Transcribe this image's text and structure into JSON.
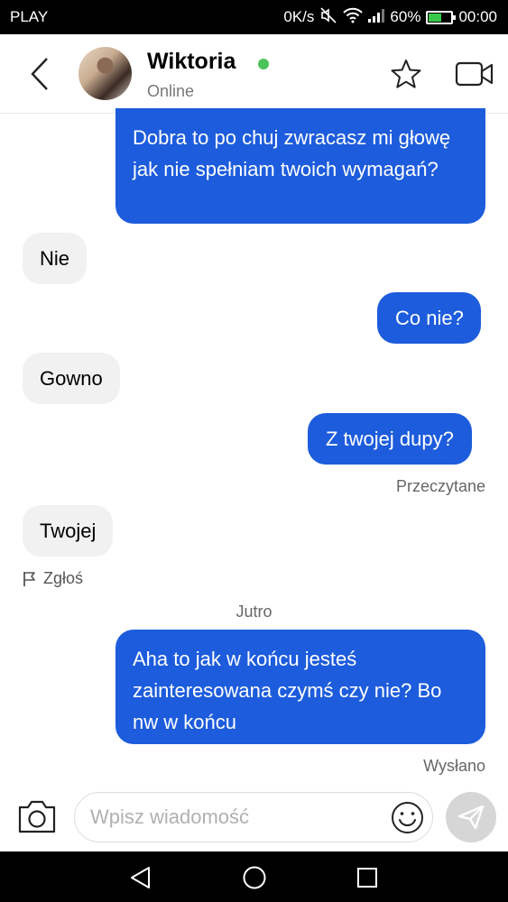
{
  "status_bar": {
    "carrier": "PLAY",
    "network_speed": "0K/s",
    "battery_percent": "60%",
    "battery_level": 0.6,
    "time": "00:00"
  },
  "header": {
    "contact_name": "Wiktoria",
    "contact_status": "Online",
    "online_color": "#4cc25a",
    "icons": [
      "chevron-left-icon",
      "star-icon",
      "video-camera-icon"
    ]
  },
  "conversation": {
    "messages": [
      {
        "direction": "outgoing",
        "text": "Dobra to po chuj zwracasz mi głowę jak nie spełniam twoich wymagań?"
      },
      {
        "direction": "incoming",
        "text": "Nie"
      },
      {
        "direction": "outgoing",
        "text": "Co nie?"
      },
      {
        "direction": "incoming",
        "text": "Gowno"
      },
      {
        "direction": "outgoing",
        "text": "Z twojej dupy?"
      },
      {
        "direction": "incoming",
        "text": "Twojej"
      },
      {
        "direction": "outgoing",
        "text": "Aha to jak w końcu jesteś zainteresowana czymś czy nie? Bo nw w końcu"
      }
    ],
    "read_status": "Przeczytane",
    "report_label": "Zgłoś",
    "day_separator": "Jutro",
    "sent_status": "Wysłano"
  },
  "composer": {
    "placeholder": "Wpisz wiadomość",
    "icons": [
      "camera-icon",
      "emoji-icon",
      "send-icon"
    ]
  },
  "colors": {
    "outgoing_bubble": "#1d5cdc",
    "incoming_bubble": "#f1f1f1",
    "send_button": "#d6d6d6"
  }
}
